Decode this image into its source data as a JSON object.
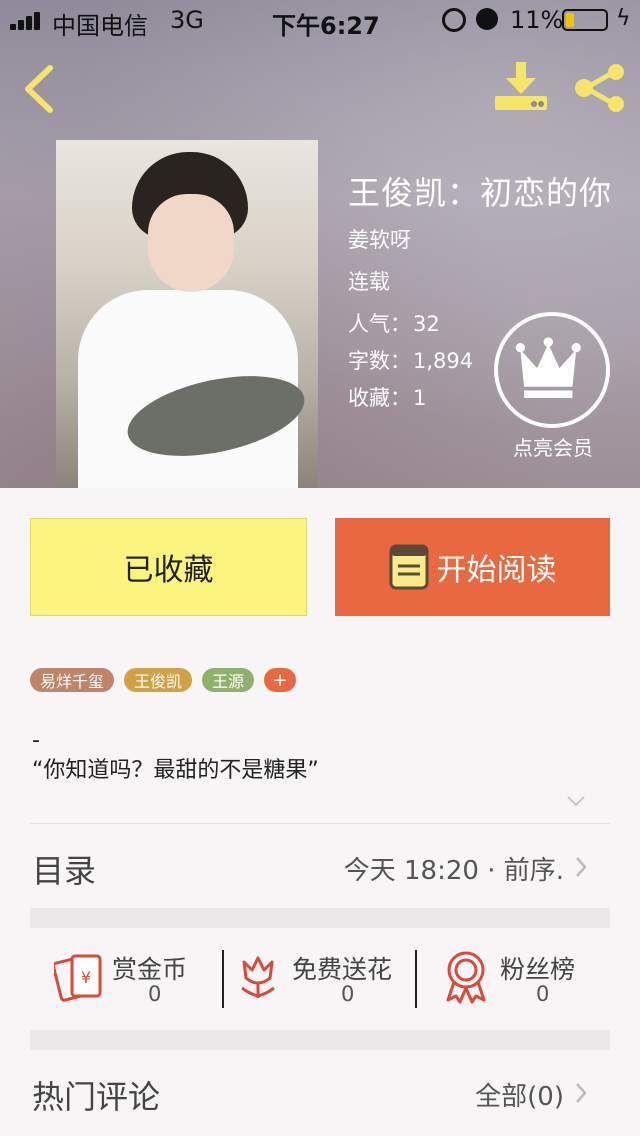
{
  "status_bar": {
    "carrier": "中国电信",
    "network": "3G",
    "time": "下午6:27",
    "battery_percent": "11%",
    "battery_level": 0.11
  },
  "header": {
    "back_icon": "chevron-left-icon",
    "download_icon": "download-icon",
    "share_icon": "share-icon",
    "accent_color": "#f5e56b"
  },
  "book": {
    "title": "王俊凯：初恋的你",
    "author": "姜软呀",
    "status": "连载",
    "popularity_label": "人气：",
    "popularity_value": "32",
    "word_count_label": "字数：",
    "word_count_value": "1,894",
    "favorites_label": "收藏：",
    "favorites_value": "1"
  },
  "vip": {
    "label": "点亮会员",
    "icon": "crown-icon"
  },
  "actions": {
    "favorited_label": "已收藏",
    "read_label": "开始阅读"
  },
  "tags": [
    {
      "label": "易烊千玺",
      "color": "#c08468"
    },
    {
      "label": "王俊凯",
      "color": "#d1a145"
    },
    {
      "label": "王源",
      "color": "#8fb16c"
    },
    {
      "label": "+",
      "color": "#e8693f"
    }
  ],
  "intro": {
    "line1": "-",
    "line2": "“你知道吗？最甜的不是糖果”"
  },
  "toc": {
    "title": "目录",
    "latest": "今天 18:20 · 前序."
  },
  "rewards": [
    {
      "label": "赏金币",
      "count": "0",
      "icon": "red-envelope-icon"
    },
    {
      "label": "免费送花",
      "count": "0",
      "icon": "flower-icon"
    },
    {
      "label": "粉丝榜",
      "count": "0",
      "icon": "ribbon-medal-icon"
    }
  ],
  "comments": {
    "title": "热门评论",
    "all_label": "全部(0)"
  }
}
